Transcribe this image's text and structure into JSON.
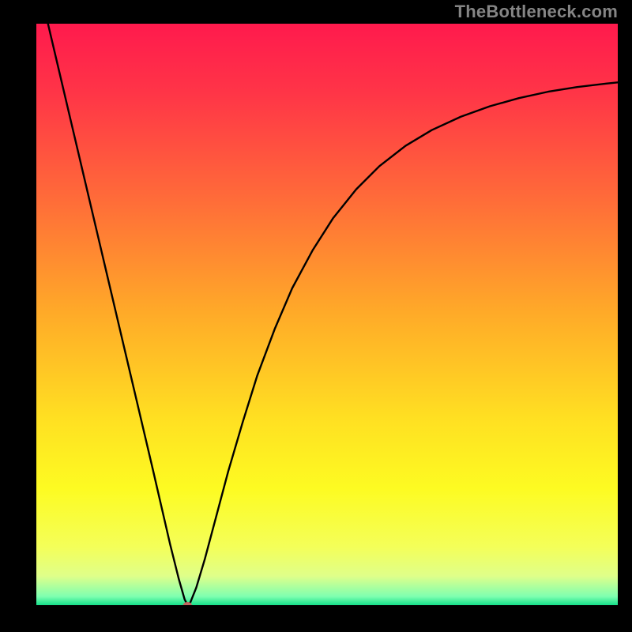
{
  "watermark": "TheBottleneck.com",
  "chart_data": {
    "type": "line",
    "title": "",
    "xlabel": "",
    "ylabel": "",
    "xlim": [
      0,
      100
    ],
    "ylim": [
      0,
      100
    ],
    "grid": false,
    "legend": false,
    "background_gradient_stops": [
      {
        "offset": 0.0,
        "color": "#ff1a4d"
      },
      {
        "offset": 0.12,
        "color": "#ff3547"
      },
      {
        "offset": 0.3,
        "color": "#ff6b39"
      },
      {
        "offset": 0.5,
        "color": "#ffab28"
      },
      {
        "offset": 0.68,
        "color": "#ffe022"
      },
      {
        "offset": 0.8,
        "color": "#fdfb22"
      },
      {
        "offset": 0.9,
        "color": "#f4ff59"
      },
      {
        "offset": 0.95,
        "color": "#dfff8a"
      },
      {
        "offset": 0.985,
        "color": "#7fffb0"
      },
      {
        "offset": 1.0,
        "color": "#15e08a"
      }
    ],
    "series": [
      {
        "name": "bottleneck-curve",
        "color": "#000000",
        "stroke_width": 2.4,
        "points": [
          {
            "x": 2.0,
            "y": 100.0
          },
          {
            "x": 4.0,
            "y": 91.5
          },
          {
            "x": 6.0,
            "y": 83.0
          },
          {
            "x": 8.0,
            "y": 74.5
          },
          {
            "x": 10.0,
            "y": 66.0
          },
          {
            "x": 12.0,
            "y": 57.5
          },
          {
            "x": 14.0,
            "y": 49.0
          },
          {
            "x": 16.0,
            "y": 40.5
          },
          {
            "x": 18.0,
            "y": 32.0
          },
          {
            "x": 20.0,
            "y": 23.5
          },
          {
            "x": 21.5,
            "y": 17.0
          },
          {
            "x": 23.0,
            "y": 10.5
          },
          {
            "x": 24.5,
            "y": 4.5
          },
          {
            "x": 25.5,
            "y": 1.0
          },
          {
            "x": 26.0,
            "y": 0.0
          },
          {
            "x": 26.5,
            "y": 0.5
          },
          {
            "x": 27.5,
            "y": 3.0
          },
          {
            "x": 29.0,
            "y": 8.0
          },
          {
            "x": 31.0,
            "y": 15.5
          },
          {
            "x": 33.0,
            "y": 23.0
          },
          {
            "x": 35.5,
            "y": 31.5
          },
          {
            "x": 38.0,
            "y": 39.5
          },
          {
            "x": 41.0,
            "y": 47.5
          },
          {
            "x": 44.0,
            "y": 54.5
          },
          {
            "x": 47.5,
            "y": 61.0
          },
          {
            "x": 51.0,
            "y": 66.5
          },
          {
            "x": 55.0,
            "y": 71.5
          },
          {
            "x": 59.0,
            "y": 75.5
          },
          {
            "x": 63.5,
            "y": 79.0
          },
          {
            "x": 68.0,
            "y": 81.7
          },
          {
            "x": 73.0,
            "y": 84.0
          },
          {
            "x": 78.0,
            "y": 85.8
          },
          {
            "x": 83.0,
            "y": 87.2
          },
          {
            "x": 88.0,
            "y": 88.3
          },
          {
            "x": 93.0,
            "y": 89.1
          },
          {
            "x": 98.0,
            "y": 89.7
          },
          {
            "x": 100.0,
            "y": 89.9
          }
        ]
      }
    ],
    "markers": [
      {
        "name": "optimal-point",
        "x": 26.0,
        "y": 0.0,
        "rx": 0.75,
        "ry": 0.55,
        "color": "#c06860"
      }
    ]
  }
}
